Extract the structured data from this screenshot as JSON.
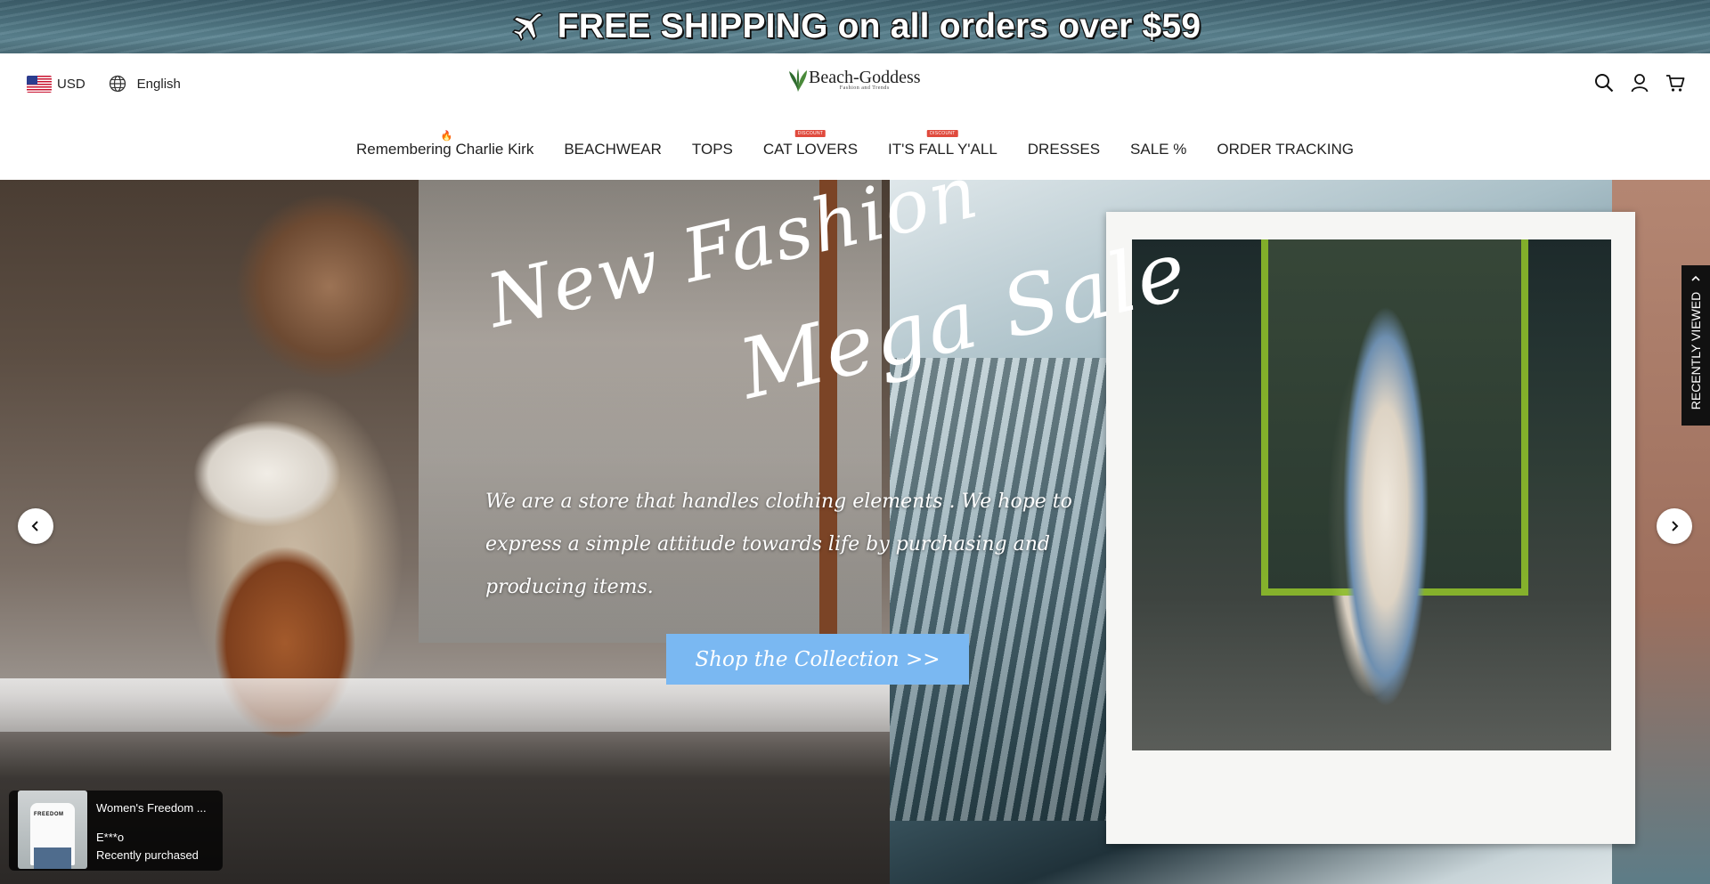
{
  "announcement": {
    "text": "FREE SHIPPING on all orders over $59",
    "icon": "airplane-icon"
  },
  "header": {
    "currency": "USD",
    "language": "English",
    "logo_name": "Beach-Goddess",
    "logo_tagline": "Fashion and Trends",
    "icons": [
      "search-icon",
      "account-icon",
      "cart-icon"
    ]
  },
  "nav": {
    "items": [
      {
        "label": "Remembering Charlie Kirk",
        "tag": "flame"
      },
      {
        "label": "BEACHWEAR",
        "tag": ""
      },
      {
        "label": "TOPS",
        "tag": ""
      },
      {
        "label": "CAT LOVERS",
        "tag": "DISCOUNT"
      },
      {
        "label": "IT'S FALL Y'ALL",
        "tag": "DISCOUNT"
      },
      {
        "label": "DRESSES",
        "tag": ""
      },
      {
        "label": "SALE %",
        "tag": ""
      },
      {
        "label": "ORDER TRACKING",
        "tag": ""
      }
    ]
  },
  "hero": {
    "title_line1": "New Fashion",
    "title_line2": "Mega Sale",
    "description": "We are a store that handles clothing elements . We hope to express a simple attitude towards life by purchasing and producing items.",
    "cta": "Shop the Collection >>",
    "cta_color": "#7ab8f2"
  },
  "sidebar_tab": {
    "label": "RECENTLY VIEWED"
  },
  "purchase_popup": {
    "product": "Women's Freedom ...",
    "thumb_text": "FREEDOM",
    "buyer": "E***o",
    "status": "Recently purchased"
  },
  "colors": {
    "discount_badge": "#e04a3d",
    "accent": "#7ab8f2"
  }
}
